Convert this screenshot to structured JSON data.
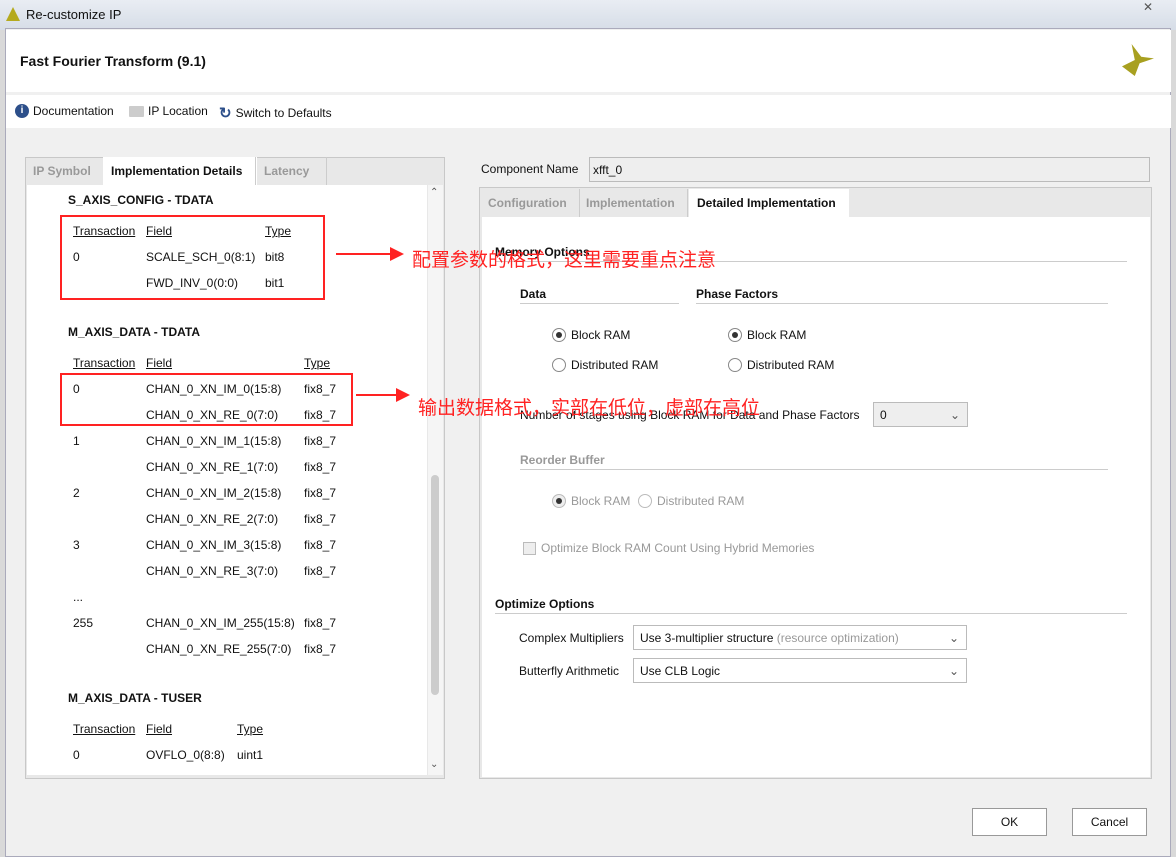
{
  "window": {
    "title": "Re-customize IP"
  },
  "header": {
    "title": "Fast Fourier Transform (9.1)"
  },
  "toolbar": {
    "documentation": "Documentation",
    "ip_location": "IP Location",
    "switch_defaults": "Switch to Defaults"
  },
  "left": {
    "tabs": [
      "IP Symbol",
      "Implementation Details",
      "Latency"
    ],
    "s_axis_config": {
      "title": "S_AXIS_CONFIG - TDATA",
      "headers": [
        "Transaction",
        "Field",
        "Type"
      ],
      "rows": [
        [
          "0",
          "SCALE_SCH_0(8:1)",
          "bit8"
        ],
        [
          "",
          "FWD_INV_0(0:0)",
          "bit1"
        ]
      ]
    },
    "m_axis_data": {
      "title": "M_AXIS_DATA - TDATA",
      "headers": [
        "Transaction",
        "Field",
        "Type"
      ],
      "rows": [
        [
          "0",
          "CHAN_0_XN_IM_0(15:8)",
          "fix8_7"
        ],
        [
          "",
          "CHAN_0_XN_RE_0(7:0)",
          "fix8_7"
        ],
        [
          "1",
          "CHAN_0_XN_IM_1(15:8)",
          "fix8_7"
        ],
        [
          "",
          "CHAN_0_XN_RE_1(7:0)",
          "fix8_7"
        ],
        [
          "2",
          "CHAN_0_XN_IM_2(15:8)",
          "fix8_7"
        ],
        [
          "",
          "CHAN_0_XN_RE_2(7:0)",
          "fix8_7"
        ],
        [
          "3",
          "CHAN_0_XN_IM_3(15:8)",
          "fix8_7"
        ],
        [
          "",
          "CHAN_0_XN_RE_3(7:0)",
          "fix8_7"
        ],
        [
          "...",
          "",
          ""
        ],
        [
          "255",
          "CHAN_0_XN_IM_255(15:8)",
          "fix8_7"
        ],
        [
          "",
          "CHAN_0_XN_RE_255(7:0)",
          "fix8_7"
        ]
      ]
    },
    "m_axis_tuser": {
      "title": "M_AXIS_DATA - TUSER",
      "headers": [
        "Transaction",
        "Field",
        "Type"
      ],
      "rows": [
        [
          "0",
          "OVFLO_0(8:8)",
          "uint1"
        ]
      ]
    }
  },
  "right": {
    "component_name_label": "Component Name",
    "component_name": "xfft_0",
    "tabs": [
      "Configuration",
      "Implementation",
      "Detailed Implementation"
    ],
    "memory_options": "Memory Options",
    "data": "Data",
    "phase_factors": "Phase Factors",
    "block_ram": "Block RAM",
    "distributed_ram": "Distributed RAM",
    "stages_label": "Number of stages using Block RAM for Data and Phase Factors",
    "stages_value": "0",
    "reorder_buffer": "Reorder Buffer",
    "optimize_hybrid": "Optimize Block RAM Count Using Hybrid Memories",
    "optimize_options": "Optimize Options",
    "complex_mult_label": "Complex Multipliers",
    "complex_mult_value": "Use 3-multiplier structure",
    "complex_mult_hint": "(resource optimization)",
    "butterfly_label": "Butterfly Arithmetic",
    "butterfly_value": "Use CLB Logic"
  },
  "annotations": {
    "config": "配置参数的格式，这里需要重点注意",
    "output": "输出数据格式，实部在低位，虚部在高位"
  },
  "footer": {
    "ok": "OK",
    "cancel": "Cancel"
  },
  "colors": {
    "annotation": "#ff2222",
    "logo": "#a8a020"
  }
}
